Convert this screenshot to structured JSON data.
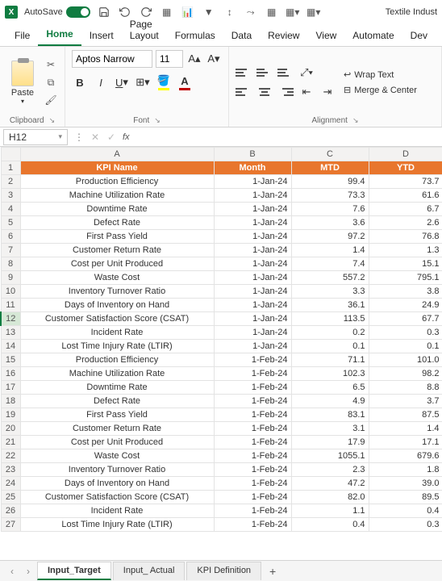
{
  "titlebar": {
    "autosave_label": "AutoSave",
    "doc_title": "Textile Indust"
  },
  "ribbon": {
    "tabs": [
      "File",
      "Home",
      "Insert",
      "Page Layout",
      "Formulas",
      "Data",
      "Review",
      "View",
      "Automate",
      "Dev"
    ],
    "active_tab": "Home",
    "clipboard": {
      "paste_label": "Paste",
      "group_label": "Clipboard"
    },
    "font": {
      "name": "Aptos Narrow",
      "size": "11",
      "group_label": "Font",
      "fill_color": "#ffff00",
      "font_color": "#c00000"
    },
    "alignment": {
      "group_label": "Alignment",
      "wrap_label": "Wrap Text",
      "merge_label": "Merge & Center"
    }
  },
  "formula_bar": {
    "name_box": "H12",
    "formula": ""
  },
  "grid": {
    "columns": [
      "A",
      "B",
      "C",
      "D"
    ],
    "headers": [
      "KPI Name",
      "Month",
      "MTD",
      "YTD"
    ],
    "selected_row": 12,
    "rows": [
      {
        "n": 1,
        "type": "header"
      },
      {
        "n": 2,
        "a": "Production Efficiency",
        "b": "1-Jan-24",
        "c": "99.4",
        "d": "73.7"
      },
      {
        "n": 3,
        "a": "Machine Utilization Rate",
        "b": "1-Jan-24",
        "c": "73.3",
        "d": "61.6"
      },
      {
        "n": 4,
        "a": "Downtime Rate",
        "b": "1-Jan-24",
        "c": "7.6",
        "d": "6.7"
      },
      {
        "n": 5,
        "a": "Defect Rate",
        "b": "1-Jan-24",
        "c": "3.6",
        "d": "2.6"
      },
      {
        "n": 6,
        "a": "First Pass Yield",
        "b": "1-Jan-24",
        "c": "97.2",
        "d": "76.8"
      },
      {
        "n": 7,
        "a": "Customer Return Rate",
        "b": "1-Jan-24",
        "c": "1.4",
        "d": "1.3"
      },
      {
        "n": 8,
        "a": "Cost per Unit Produced",
        "b": "1-Jan-24",
        "c": "7.4",
        "d": "15.1"
      },
      {
        "n": 9,
        "a": "Waste Cost",
        "b": "1-Jan-24",
        "c": "557.2",
        "d": "795.1"
      },
      {
        "n": 10,
        "a": "Inventory Turnover Ratio",
        "b": "1-Jan-24",
        "c": "3.3",
        "d": "3.8"
      },
      {
        "n": 11,
        "a": "Days of Inventory on Hand",
        "b": "1-Jan-24",
        "c": "36.1",
        "d": "24.9"
      },
      {
        "n": 12,
        "a": "Customer Satisfaction Score (CSAT)",
        "b": "1-Jan-24",
        "c": "113.5",
        "d": "67.7"
      },
      {
        "n": 13,
        "a": "Incident Rate",
        "b": "1-Jan-24",
        "c": "0.2",
        "d": "0.3"
      },
      {
        "n": 14,
        "a": "Lost Time Injury Rate (LTIR)",
        "b": "1-Jan-24",
        "c": "0.1",
        "d": "0.1"
      },
      {
        "n": 15,
        "a": "Production Efficiency",
        "b": "1-Feb-24",
        "c": "71.1",
        "d": "101.0"
      },
      {
        "n": 16,
        "a": "Machine Utilization Rate",
        "b": "1-Feb-24",
        "c": "102.3",
        "d": "98.2"
      },
      {
        "n": 17,
        "a": "Downtime Rate",
        "b": "1-Feb-24",
        "c": "6.5",
        "d": "8.8"
      },
      {
        "n": 18,
        "a": "Defect Rate",
        "b": "1-Feb-24",
        "c": "4.9",
        "d": "3.7"
      },
      {
        "n": 19,
        "a": "First Pass Yield",
        "b": "1-Feb-24",
        "c": "83.1",
        "d": "87.5"
      },
      {
        "n": 20,
        "a": "Customer Return Rate",
        "b": "1-Feb-24",
        "c": "3.1",
        "d": "1.4"
      },
      {
        "n": 21,
        "a": "Cost per Unit Produced",
        "b": "1-Feb-24",
        "c": "17.9",
        "d": "17.1"
      },
      {
        "n": 22,
        "a": "Waste Cost",
        "b": "1-Feb-24",
        "c": "1055.1",
        "d": "679.6"
      },
      {
        "n": 23,
        "a": "Inventory Turnover Ratio",
        "b": "1-Feb-24",
        "c": "2.3",
        "d": "1.8"
      },
      {
        "n": 24,
        "a": "Days of Inventory on Hand",
        "b": "1-Feb-24",
        "c": "47.2",
        "d": "39.0"
      },
      {
        "n": 25,
        "a": "Customer Satisfaction Score (CSAT)",
        "b": "1-Feb-24",
        "c": "82.0",
        "d": "89.5"
      },
      {
        "n": 26,
        "a": "Incident Rate",
        "b": "1-Feb-24",
        "c": "1.1",
        "d": "0.4"
      },
      {
        "n": 27,
        "a": "Lost Time Injury Rate (LTIR)",
        "b": "1-Feb-24",
        "c": "0.4",
        "d": "0.3"
      }
    ]
  },
  "sheets": {
    "tabs": [
      "Input_Target",
      "Input_ Actual",
      "KPI Definition"
    ],
    "active": "Input_Target"
  }
}
